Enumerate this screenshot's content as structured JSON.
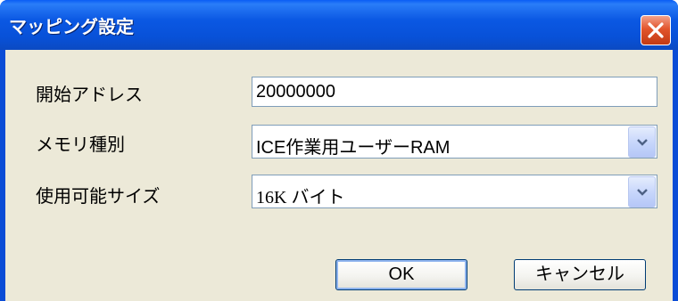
{
  "window": {
    "title": "マッピング設定",
    "close_label": "✕"
  },
  "form": {
    "start_address": {
      "label": "開始アドレス",
      "value": "20000000"
    },
    "memory_type": {
      "label": "メモリ種別",
      "selected": "ICE作業用ユーザーRAM"
    },
    "usable_size": {
      "label": "使用可能サイズ",
      "selected": "16K バイト"
    }
  },
  "buttons": {
    "ok": "OK",
    "cancel": "キャンセル"
  },
  "colors": {
    "titlebar": "#0b58e3",
    "client_background": "#ece9d8",
    "close_button": "#e2552c",
    "input_border": "#7f9db9"
  }
}
